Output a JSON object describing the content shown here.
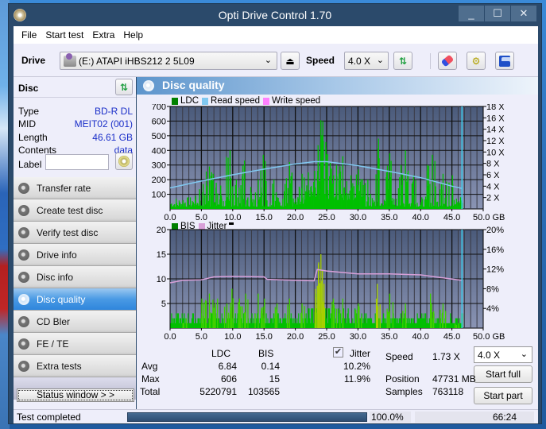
{
  "window": {
    "title": "Opti Drive Control 1.70",
    "controls": [
      "_",
      "☐",
      "✕"
    ]
  },
  "menu": [
    {
      "label": "File",
      "accel": "F"
    },
    {
      "label": "Start test",
      "accel": "S"
    },
    {
      "label": "Extra",
      "accel": "x"
    },
    {
      "label": "Help",
      "accel": "H"
    }
  ],
  "toolbar": {
    "drive_label": "Drive",
    "drive_value": "(E:)  ATAPI iHBS212   2 5L09",
    "speed_label": "Speed",
    "speed_value": "4.0 X",
    "icons": [
      "eject-icon",
      "refresh-icon",
      "erase-icon",
      "settings-icon",
      "save-icon"
    ]
  },
  "disc": {
    "header": "Disc",
    "type_label": "Type",
    "type_value": "BD-R DL",
    "mid_label": "MID",
    "mid_value": "MEIT02 (001)",
    "length_label": "Length",
    "length_value": "46.61 GB",
    "contents_label": "Contents",
    "contents_value": "data",
    "label_label": "Label",
    "label_value": ""
  },
  "nav": [
    {
      "label": "Transfer rate",
      "active": false
    },
    {
      "label": "Create test disc",
      "active": false
    },
    {
      "label": "Verify test disc",
      "active": false
    },
    {
      "label": "Drive info",
      "active": false
    },
    {
      "label": "Disc info",
      "active": false
    },
    {
      "label": "Disc quality",
      "active": true
    },
    {
      "label": "CD Bler",
      "active": false
    },
    {
      "label": "FE / TE",
      "active": false
    },
    {
      "label": "Extra tests",
      "active": false
    }
  ],
  "status_window_button": "Status window > >",
  "main": {
    "title": "Disc quality"
  },
  "colors": {
    "ldc": "#00c000",
    "ldc_legend": "#008000",
    "read_speed": "#80c8f0",
    "write_speed": "#ff80ff",
    "bis": "#00c000",
    "bis_legend": "#008000",
    "jitter": "#d8a0d8",
    "plot_bg_top": "#4a5a7a",
    "plot_bg_bottom": "#8a94b4",
    "marker": "#40d0f0",
    "value_text": "#1a2ec8"
  },
  "chart_data": [
    {
      "type": "bar",
      "title": "LDC / Read speed",
      "legend": [
        "LDC",
        "Read speed",
        "Write speed"
      ],
      "legend_placement": "top-left",
      "xlabel": "GB",
      "x_ticks": [
        "0.0",
        "5.0",
        "10.0",
        "15.0",
        "20.0",
        "25.0",
        "30.0",
        "35.0",
        "40.0",
        "45.0",
        "50.0 GB"
      ],
      "xlim": [
        0,
        50
      ],
      "y_left_ticks": [
        "100",
        "200",
        "300",
        "400",
        "500",
        "600",
        "700"
      ],
      "ylim_left": [
        0,
        700
      ],
      "y_right_ticks": [
        "2 X",
        "4 X",
        "6 X",
        "8 X",
        "10 X",
        "12 X",
        "14 X",
        "16 X",
        "18 X"
      ],
      "ylim_right": [
        0,
        18
      ],
      "grid": true,
      "end_marker_gb": 46.61,
      "ldc_peaks": [
        {
          "x": 2.0,
          "y": 60
        },
        {
          "x": 4.0,
          "y": 90
        },
        {
          "x": 5.2,
          "y": 170
        },
        {
          "x": 6.2,
          "y": 290
        },
        {
          "x": 6.8,
          "y": 240
        },
        {
          "x": 8.0,
          "y": 160
        },
        {
          "x": 9.5,
          "y": 400
        },
        {
          "x": 10.5,
          "y": 200
        },
        {
          "x": 11.8,
          "y": 330
        },
        {
          "x": 12.8,
          "y": 150
        },
        {
          "x": 14.0,
          "y": 200
        },
        {
          "x": 14.8,
          "y": 370
        },
        {
          "x": 16.5,
          "y": 200
        },
        {
          "x": 18.5,
          "y": 210
        },
        {
          "x": 19.0,
          "y": 320
        },
        {
          "x": 21.0,
          "y": 240
        },
        {
          "x": 22.0,
          "y": 250
        },
        {
          "x": 23.0,
          "y": 260
        },
        {
          "x": 23.6,
          "y": 400
        },
        {
          "x": 24.0,
          "y": 606
        },
        {
          "x": 24.3,
          "y": 600
        },
        {
          "x": 24.8,
          "y": 420
        },
        {
          "x": 25.5,
          "y": 320
        },
        {
          "x": 26.5,
          "y": 300
        },
        {
          "x": 27.5,
          "y": 360
        },
        {
          "x": 28.8,
          "y": 230
        },
        {
          "x": 30.0,
          "y": 270
        },
        {
          "x": 31.5,
          "y": 200
        },
        {
          "x": 33.2,
          "y": 480
        },
        {
          "x": 34.5,
          "y": 250
        },
        {
          "x": 35.0,
          "y": 380
        },
        {
          "x": 36.8,
          "y": 300
        },
        {
          "x": 37.5,
          "y": 400
        },
        {
          "x": 38.8,
          "y": 230
        },
        {
          "x": 41.0,
          "y": 300
        },
        {
          "x": 41.8,
          "y": 370
        },
        {
          "x": 43.5,
          "y": 240
        },
        {
          "x": 45.0,
          "y": 230
        },
        {
          "x": 46.3,
          "y": 80
        }
      ],
      "read_speed": [
        {
          "x": 0,
          "y": 3.7
        },
        {
          "x": 5,
          "y": 4.9
        },
        {
          "x": 10,
          "y": 6.0
        },
        {
          "x": 15,
          "y": 7.0
        },
        {
          "x": 20,
          "y": 7.9
        },
        {
          "x": 23,
          "y": 8.3
        },
        {
          "x": 25,
          "y": 8.3
        },
        {
          "x": 30,
          "y": 7.6
        },
        {
          "x": 35,
          "y": 6.6
        },
        {
          "x": 40,
          "y": 5.5
        },
        {
          "x": 45,
          "y": 4.0
        },
        {
          "x": 46.61,
          "y": 3.6
        }
      ]
    },
    {
      "type": "bar",
      "title": "BIS / Jitter",
      "legend": [
        "BIS",
        "Jitter"
      ],
      "legend_placement": "top-left",
      "xlabel": "GB",
      "x_ticks": [
        "0.0",
        "5.0",
        "10.0",
        "15.0",
        "20.0",
        "25.0",
        "30.0",
        "35.0",
        "40.0",
        "45.0",
        "50.0 GB"
      ],
      "xlim": [
        0,
        50
      ],
      "y_left_ticks": [
        "5",
        "10",
        "15",
        "20"
      ],
      "ylim_left": [
        0,
        20
      ],
      "y_right_ticks": [
        "4%",
        "8%",
        "12%",
        "16%",
        "20%"
      ],
      "ylim_right": [
        0,
        20
      ],
      "grid": true,
      "end_marker_gb": 46.61,
      "bis_peaks": [
        {
          "x": 2.5,
          "y": 2
        },
        {
          "x": 5.0,
          "y": 6
        },
        {
          "x": 6.2,
          "y": 7
        },
        {
          "x": 7.5,
          "y": 6
        },
        {
          "x": 9.0,
          "y": 5
        },
        {
          "x": 9.8,
          "y": 8
        },
        {
          "x": 11.0,
          "y": 6
        },
        {
          "x": 12.0,
          "y": 7
        },
        {
          "x": 14.0,
          "y": 7
        },
        {
          "x": 15.0,
          "y": 6
        },
        {
          "x": 17.0,
          "y": 5
        },
        {
          "x": 19.0,
          "y": 6
        },
        {
          "x": 21.0,
          "y": 5
        },
        {
          "x": 23.2,
          "y": 7
        },
        {
          "x": 23.6,
          "y": 13
        },
        {
          "x": 24.0,
          "y": 15
        },
        {
          "x": 24.5,
          "y": 9
        },
        {
          "x": 26.0,
          "y": 6
        },
        {
          "x": 27.5,
          "y": 6
        },
        {
          "x": 30.0,
          "y": 5
        },
        {
          "x": 33.0,
          "y": 9
        },
        {
          "x": 35.0,
          "y": 7
        },
        {
          "x": 37.5,
          "y": 5
        },
        {
          "x": 41.5,
          "y": 7
        },
        {
          "x": 43.5,
          "y": 5
        },
        {
          "x": 46.0,
          "y": 1
        }
      ],
      "jitter_pct": [
        {
          "x": 0,
          "y": 9.2
        },
        {
          "x": 2,
          "y": 9.7
        },
        {
          "x": 5,
          "y": 9.8
        },
        {
          "x": 7,
          "y": 10.4
        },
        {
          "x": 10,
          "y": 10.5
        },
        {
          "x": 15,
          "y": 10.4
        },
        {
          "x": 15.5,
          "y": 9.9
        },
        {
          "x": 20,
          "y": 9.7
        },
        {
          "x": 23,
          "y": 9.6
        },
        {
          "x": 23.5,
          "y": 11.9
        },
        {
          "x": 25,
          "y": 11.6
        },
        {
          "x": 30,
          "y": 11.0
        },
        {
          "x": 35,
          "y": 11.0
        },
        {
          "x": 40,
          "y": 10.8
        },
        {
          "x": 43,
          "y": 10.3
        },
        {
          "x": 46.61,
          "y": 9.7
        }
      ]
    }
  ],
  "stats": {
    "col_ldc": "LDC",
    "col_bis": "BIS",
    "col_jitter": "Jitter",
    "jitter_checked": true,
    "row_avg": "Avg",
    "avg_ldc": "6.84",
    "avg_bis": "0.14",
    "avg_jitter": "10.2%",
    "row_max": "Max",
    "max_ldc": "606",
    "max_bis": "15",
    "max_jitter": "11.9%",
    "row_total": "Total",
    "total_ldc": "5220791",
    "total_bis": "103565"
  },
  "run": {
    "speed_label": "Speed",
    "speed_value": "1.73 X",
    "speed_select": "4.0 X",
    "position_label": "Position",
    "position_value": "47731 MB",
    "samples_label": "Samples",
    "samples_value": "763118",
    "start_full": "Start full",
    "start_part": "Start part"
  },
  "statusbar": {
    "text": "Test completed",
    "progress_pct": 100.0,
    "progress_label": "100.0%",
    "elapsed": "66:24"
  }
}
